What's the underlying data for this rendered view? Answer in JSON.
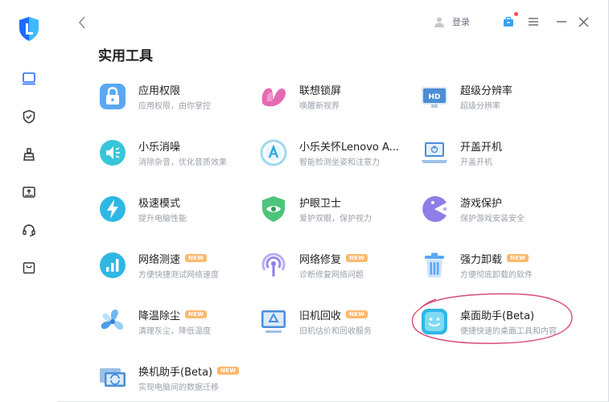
{
  "topbar": {
    "login_label": "登录"
  },
  "page_title": "实用工具",
  "new_badge": "NEW",
  "tools": [
    {
      "name": "应用权限",
      "desc": "应用权限，由你掌控",
      "new": false
    },
    {
      "name": "联想锁屏",
      "desc": "唤醒新视界",
      "new": false
    },
    {
      "name": "超级分辨率",
      "desc": "超级分辨率",
      "new": false
    },
    {
      "name": "小乐消噪",
      "desc": "消除杂音，优化音质效果",
      "new": false
    },
    {
      "name": "小乐关怀Lenovo A...",
      "desc": "智能检测坐姿和注意力",
      "new": false
    },
    {
      "name": "开盖开机",
      "desc": "开盖开机",
      "new": false
    },
    {
      "name": "极速模式",
      "desc": "提升电脑性能",
      "new": false
    },
    {
      "name": "护眼卫士",
      "desc": "爱护双眼，保护视力",
      "new": false
    },
    {
      "name": "游戏保护",
      "desc": "保护游戏安装安全",
      "new": false
    },
    {
      "name": "网络测速",
      "desc": "方便快捷测试网络速度",
      "new": true
    },
    {
      "name": "网络修复",
      "desc": "诊断修复网络问题",
      "new": true
    },
    {
      "name": "强力卸载",
      "desc": "方便彻底卸载的软件",
      "new": true
    },
    {
      "name": "降温除尘",
      "desc": "清理灰尘，降低温度",
      "new": true
    },
    {
      "name": "旧机回收",
      "desc": "旧机估价和回收服务",
      "new": true
    },
    {
      "name": "桌面助手(Beta)",
      "desc": "便捷快速的桌面工具和内容",
      "new": false
    },
    {
      "name": "换机助手(Beta)",
      "desc": "实现电脑间的数据迁移",
      "new": true
    }
  ],
  "colors": {
    "brand_blue": "#1f6bff",
    "annotation_pink": "#d94a7a",
    "new_badge": "#ffb86b"
  }
}
